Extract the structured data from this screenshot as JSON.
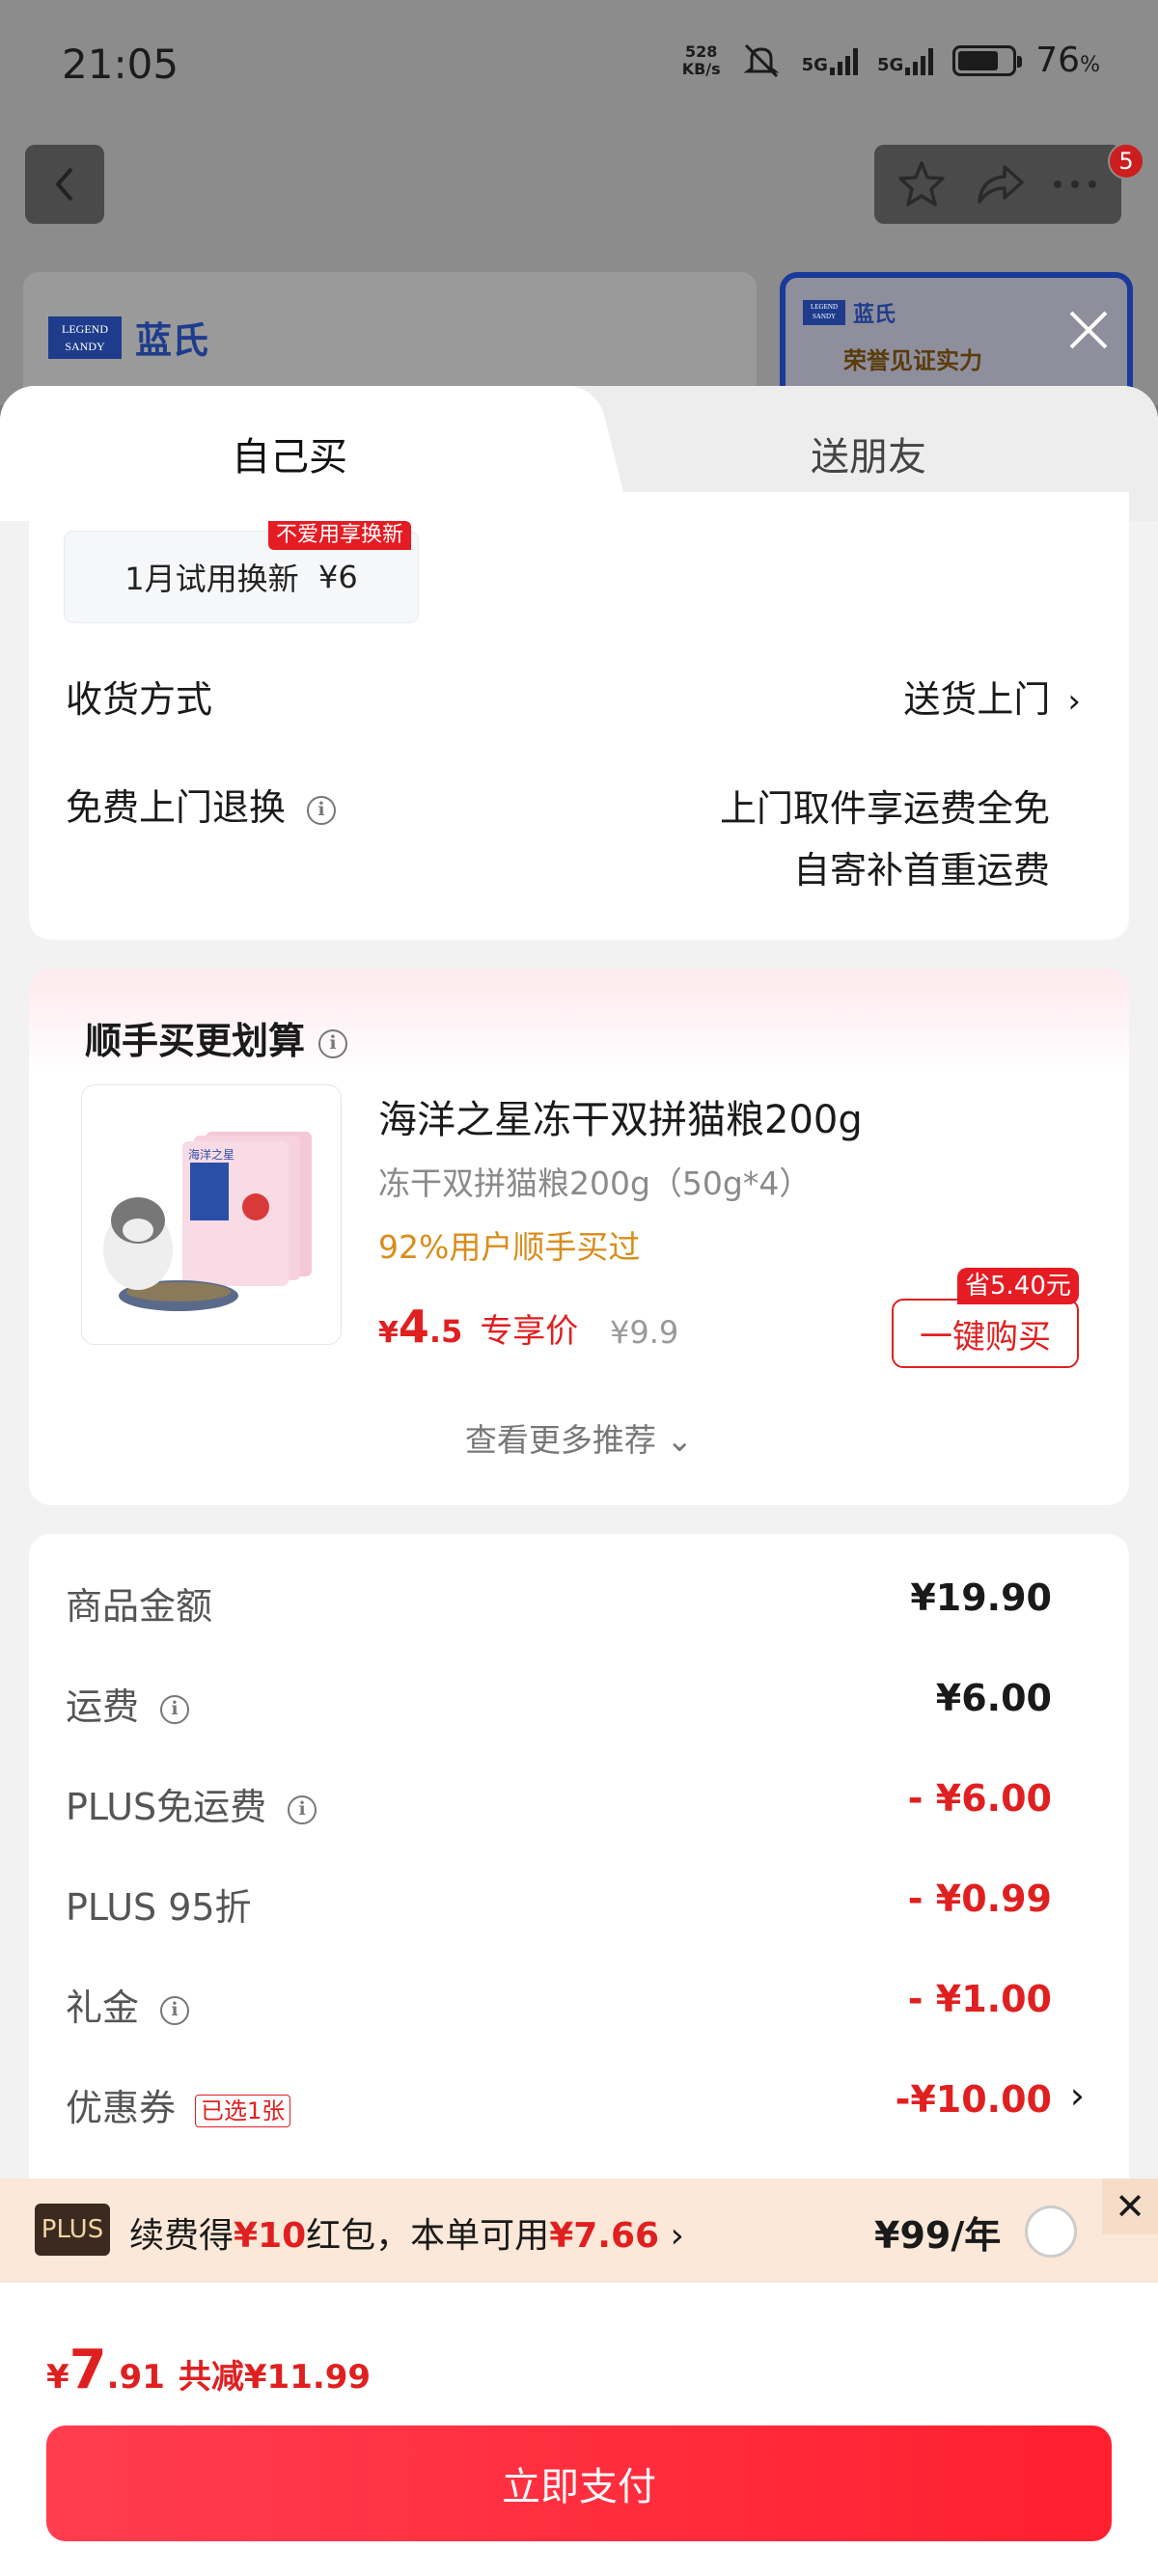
{
  "status_bar": {
    "time": "21:05",
    "net_speed_value": "528",
    "net_speed_unit": "KB/s",
    "sig1": "5G",
    "sig2": "5G",
    "battery_pct": "76",
    "battery_pct_unit": "%",
    "battery_level": 0.76
  },
  "nav": {
    "badge_count": "5"
  },
  "brand": {
    "legend": "LEGEND SANDY",
    "name": "蓝氏",
    "promo_title": "荣誉见证实力"
  },
  "tabs": {
    "self": "自己买",
    "friend": "送朋友"
  },
  "delivery": {
    "trial_label": "1月试用换新",
    "trial_price": "¥6",
    "trial_tag": "不爱用享换新",
    "method_label": "收货方式",
    "method_value": "送货上门",
    "return_label": "免费上门退换",
    "return_line1": "上门取件享运费全免",
    "return_line2": "自寄补首重运费"
  },
  "recommend": {
    "title": "顺手买更划算",
    "product_name": "海洋之星冻干双拼猫粮200g",
    "product_sub": "冻干双拼猫粮200g（50g*4）",
    "social_proof": "92%用户顺手买过",
    "price_yen": "¥",
    "price_int": "4",
    "price_dec": ".5",
    "exclusive": "专享价",
    "orig_price": "¥9.9",
    "save_tag": "省5.40元",
    "buy_label": "一键购买",
    "see_more": "查看更多推荐",
    "pkg_brand": "海洋之星"
  },
  "price_detail": {
    "rows": [
      {
        "label": "商品金额",
        "value": "¥19.90"
      },
      {
        "label": "运费",
        "value": "¥6.00"
      },
      {
        "label": "PLUS免运费",
        "value": "- ¥6.00"
      },
      {
        "label": "PLUS 95折",
        "value": "- ¥0.99"
      },
      {
        "label": "礼金",
        "value": "- ¥1.00"
      },
      {
        "label": "优惠券",
        "value": "-¥10.00"
      }
    ],
    "coupon_tag": "已选1张"
  },
  "plus_bar": {
    "badge": "PLUS",
    "text_a": "续费得",
    "text_b": "¥10",
    "text_c": "红包，本单可用",
    "text_d": "¥7.66",
    "price": "¥99/年"
  },
  "bottom": {
    "yen": "¥",
    "total_int": "7",
    "total_dec": ".91",
    "saved": "共减¥11.99",
    "pay_label": "立即支付"
  },
  "colors": {
    "accent_red": "#e02020",
    "gold_text": "#d98c1a",
    "plus_bar_bg": "#fbe8d8"
  }
}
